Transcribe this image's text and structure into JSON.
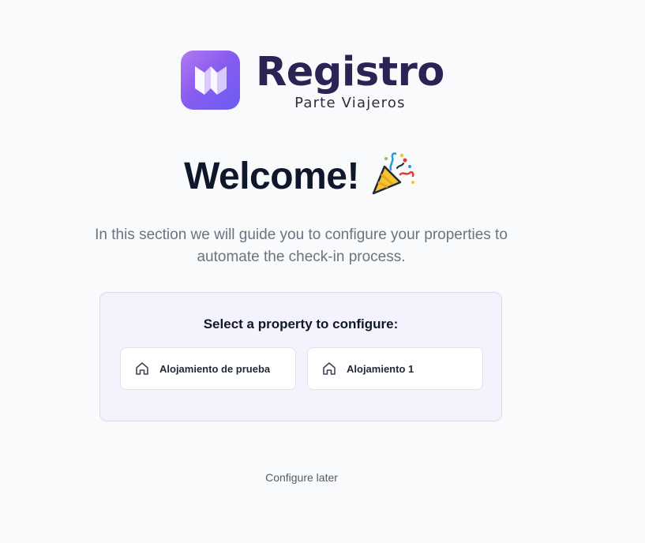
{
  "brand": {
    "title": "Registro",
    "subtitle": "Parte Viajeros",
    "gradient_start": "#b07bf2",
    "gradient_end": "#6a5cf2",
    "title_color": "#2d2254"
  },
  "welcome": {
    "title": "Welcome!",
    "icon": "party-popper-icon",
    "description": "In this section we will guide you to configure your properties to automate the check-in process."
  },
  "property_panel": {
    "title": "Select a property to configure:",
    "properties": [
      {
        "label": "Alojamiento de prueba",
        "icon": "home-icon"
      },
      {
        "label": "Alojamiento 1",
        "icon": "home-icon"
      }
    ]
  },
  "actions": {
    "configure_later": "Configure later"
  }
}
